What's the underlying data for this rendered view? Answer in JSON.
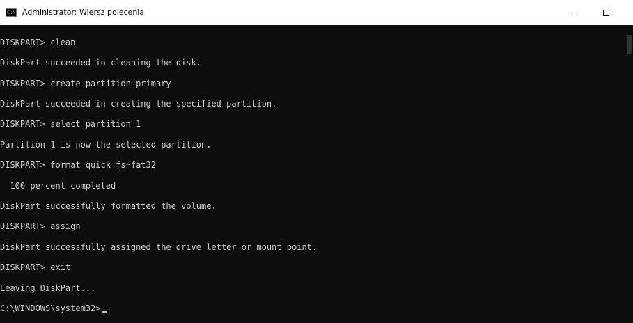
{
  "window": {
    "title": "Administrator: Wiersz polecenia",
    "icon": "cmd-icon",
    "controls": {
      "minimize": "minimize-icon",
      "maximize": "maximize-icon",
      "close": "close-icon"
    }
  },
  "console": {
    "lines": [
      "DISKPART> clean",
      "DiskPart succeeded in cleaning the disk.",
      "DISKPART> create partition primary",
      "DiskPart succeeded in creating the specified partition.",
      "DISKPART> select partition 1",
      "Partition 1 is now the selected partition.",
      "DISKPART> format quick fs=fat32",
      "  100 percent completed",
      "DiskPart successfully formatted the volume.",
      "DISKPART> assign",
      "DiskPart successfully assigned the drive letter or mount point.",
      "DISKPART> exit",
      "Leaving DiskPart...",
      "C:\\WINDOWS\\system32>"
    ]
  },
  "colors": {
    "console_bg": "#0c0c0c",
    "console_fg": "#cccccc",
    "titlebar_bg": "#ffffff"
  }
}
